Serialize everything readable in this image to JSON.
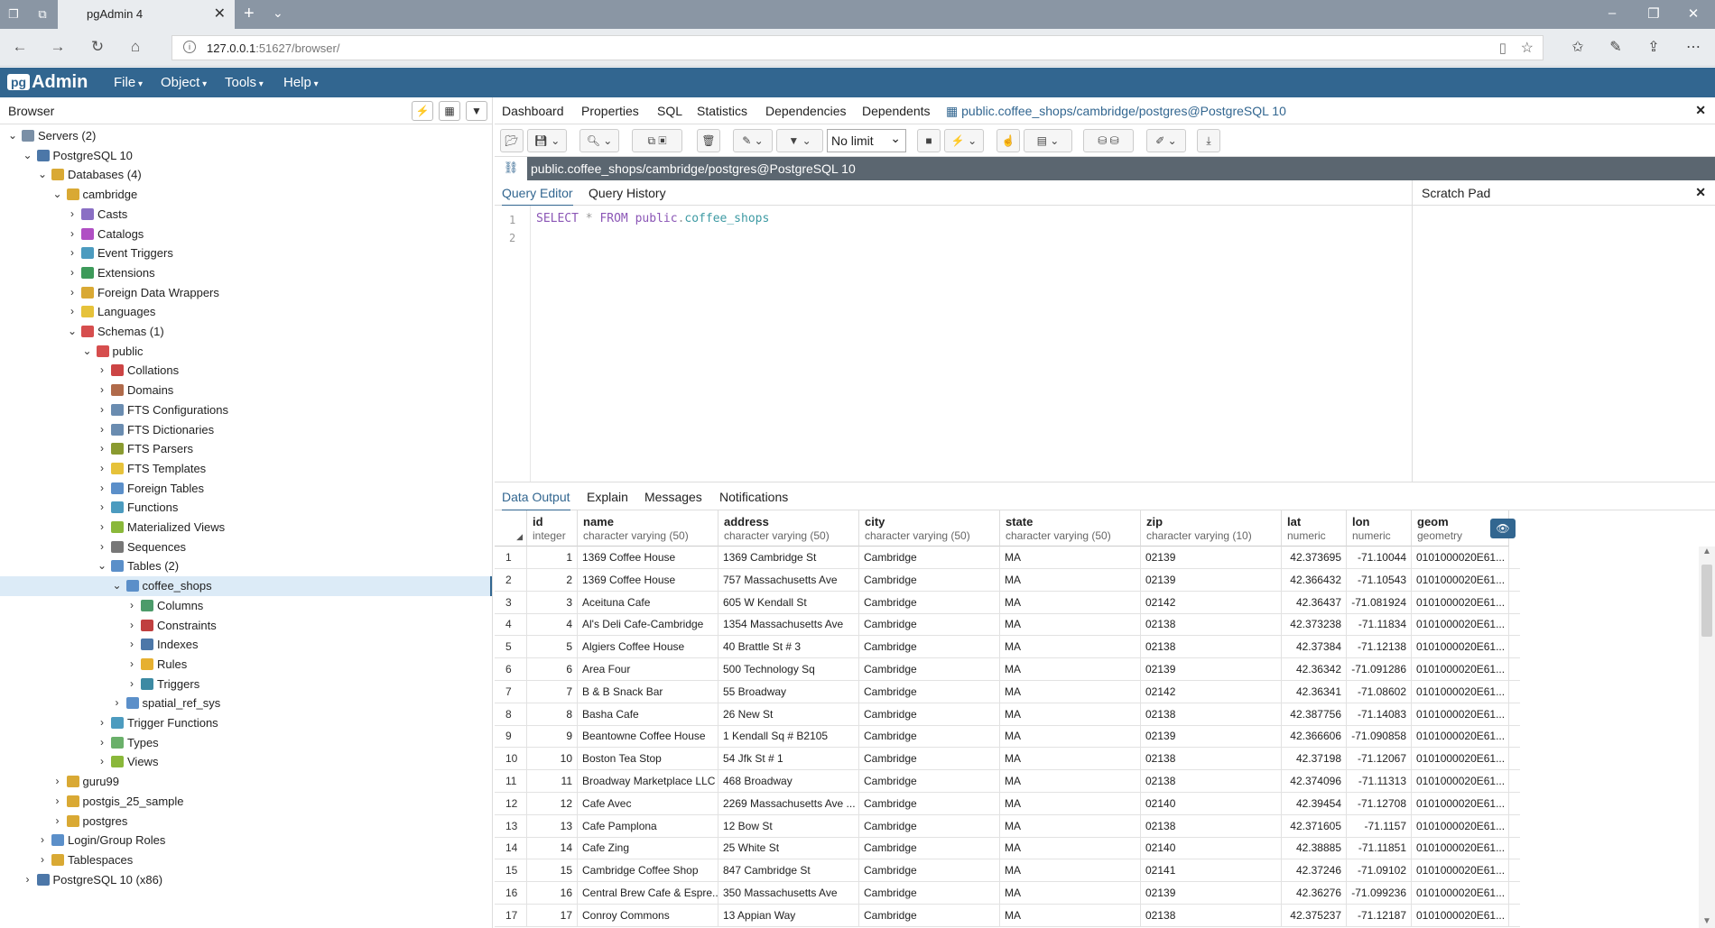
{
  "browser_chrome": {
    "tab_title": "pgAdmin 4",
    "url_host": "127.0.0.1",
    "url_rest": ":51627/browser/"
  },
  "menubar": {
    "logo_pg": "pg",
    "logo_admin": "Admin",
    "items": [
      "File",
      "Object",
      "Tools",
      "Help"
    ]
  },
  "browser_panel": {
    "title": "Browser",
    "tree": [
      {
        "label": "Servers (2)",
        "level": 0,
        "toggle": "open",
        "icon": "servers"
      },
      {
        "label": "PostgreSQL 10",
        "level": 1,
        "toggle": "open",
        "icon": "server"
      },
      {
        "label": "Databases (4)",
        "level": 2,
        "toggle": "open",
        "icon": "databases"
      },
      {
        "label": "cambridge",
        "level": 3,
        "toggle": "open",
        "icon": "database"
      },
      {
        "label": "Casts",
        "level": 4,
        "toggle": "closed",
        "icon": "casts"
      },
      {
        "label": "Catalogs",
        "level": 4,
        "toggle": "closed",
        "icon": "catalogs"
      },
      {
        "label": "Event Triggers",
        "level": 4,
        "toggle": "closed",
        "icon": "event"
      },
      {
        "label": "Extensions",
        "level": 4,
        "toggle": "closed",
        "icon": "extensions"
      },
      {
        "label": "Foreign Data Wrappers",
        "level": 4,
        "toggle": "closed",
        "icon": "fdw"
      },
      {
        "label": "Languages",
        "level": 4,
        "toggle": "closed",
        "icon": "languages"
      },
      {
        "label": "Schemas (1)",
        "level": 4,
        "toggle": "open",
        "icon": "schemas"
      },
      {
        "label": "public",
        "level": 5,
        "toggle": "open",
        "icon": "schema"
      },
      {
        "label": "Collations",
        "level": 6,
        "toggle": "closed",
        "icon": "collations"
      },
      {
        "label": "Domains",
        "level": 6,
        "toggle": "closed",
        "icon": "domains"
      },
      {
        "label": "FTS Configurations",
        "level": 6,
        "toggle": "closed",
        "icon": "fts"
      },
      {
        "label": "FTS Dictionaries",
        "level": 6,
        "toggle": "closed",
        "icon": "fts"
      },
      {
        "label": "FTS Parsers",
        "level": 6,
        "toggle": "closed",
        "icon": "fts-parser"
      },
      {
        "label": "FTS Templates",
        "level": 6,
        "toggle": "closed",
        "icon": "fts-template"
      },
      {
        "label": "Foreign Tables",
        "level": 6,
        "toggle": "closed",
        "icon": "table"
      },
      {
        "label": "Functions",
        "level": 6,
        "toggle": "closed",
        "icon": "functions"
      },
      {
        "label": "Materialized Views",
        "level": 6,
        "toggle": "closed",
        "icon": "views"
      },
      {
        "label": "Sequences",
        "level": 6,
        "toggle": "closed",
        "icon": "sequences"
      },
      {
        "label": "Tables (2)",
        "level": 6,
        "toggle": "open",
        "icon": "table"
      },
      {
        "label": "coffee_shops",
        "level": 7,
        "toggle": "open",
        "icon": "table",
        "selected": true
      },
      {
        "label": "Columns",
        "level": 8,
        "toggle": "closed",
        "icon": "columns"
      },
      {
        "label": "Constraints",
        "level": 8,
        "toggle": "closed",
        "icon": "constraints"
      },
      {
        "label": "Indexes",
        "level": 8,
        "toggle": "closed",
        "icon": "indexes"
      },
      {
        "label": "Rules",
        "level": 8,
        "toggle": "closed",
        "icon": "rules"
      },
      {
        "label": "Triggers",
        "level": 8,
        "toggle": "closed",
        "icon": "triggers"
      },
      {
        "label": "spatial_ref_sys",
        "level": 7,
        "toggle": "closed",
        "icon": "table"
      },
      {
        "label": "Trigger Functions",
        "level": 6,
        "toggle": "closed",
        "icon": "functions"
      },
      {
        "label": "Types",
        "level": 6,
        "toggle": "closed",
        "icon": "types"
      },
      {
        "label": "Views",
        "level": 6,
        "toggle": "closed",
        "icon": "views"
      },
      {
        "label": "guru99",
        "level": 3,
        "toggle": "closed",
        "icon": "database"
      },
      {
        "label": "postgis_25_sample",
        "level": 3,
        "toggle": "closed",
        "icon": "database"
      },
      {
        "label": "postgres",
        "level": 3,
        "toggle": "closed",
        "icon": "database"
      },
      {
        "label": "Login/Group Roles",
        "level": 2,
        "toggle": "closed",
        "icon": "roles"
      },
      {
        "label": "Tablespaces",
        "level": 2,
        "toggle": "closed",
        "icon": "tablespaces"
      },
      {
        "label": "PostgreSQL 10 (x86)",
        "level": 1,
        "toggle": "closed",
        "icon": "server"
      }
    ]
  },
  "main_tabs": [
    "Dashboard",
    "Properties",
    "SQL",
    "Statistics",
    "Dependencies",
    "Dependents",
    "public.coffee_shops/cambridge/postgres@PostgreSQL 10"
  ],
  "toolbar": {
    "limit": "No limit"
  },
  "connection": "public.coffee_shops/cambridge/postgres@PostgreSQL 10",
  "editor_tabs": [
    "Query Editor",
    "Query History"
  ],
  "scratch_pad": "Scratch Pad",
  "editor": {
    "lines": [
      "1",
      "2"
    ],
    "kw_select": "SELECT",
    "star": "*",
    "kw_from": "FROM",
    "schema": "public",
    "dot": ".",
    "table": "coffee_shops"
  },
  "output_tabs": [
    "Data Output",
    "Explain",
    "Messages",
    "Notifications"
  ],
  "grid": {
    "columns": [
      {
        "name": "id",
        "type": "integer"
      },
      {
        "name": "name",
        "type": "character varying (50)"
      },
      {
        "name": "address",
        "type": "character varying (50)"
      },
      {
        "name": "city",
        "type": "character varying (50)"
      },
      {
        "name": "state",
        "type": "character varying (50)"
      },
      {
        "name": "zip",
        "type": "character varying (10)"
      },
      {
        "name": "lat",
        "type": "numeric"
      },
      {
        "name": "lon",
        "type": "numeric"
      },
      {
        "name": "geom",
        "type": "geometry"
      }
    ],
    "rows": [
      [
        "1",
        "1",
        "1369 Coffee House",
        "1369 Cambridge St",
        "Cambridge",
        "MA",
        "02139",
        "42.373695",
        "-71.10044",
        "0101000020E61..."
      ],
      [
        "2",
        "2",
        "1369 Coffee House",
        "757 Massachusetts Ave",
        "Cambridge",
        "MA",
        "02139",
        "42.366432",
        "-71.10543",
        "0101000020E61..."
      ],
      [
        "3",
        "3",
        "Aceituna Cafe",
        "605 W Kendall St",
        "Cambridge",
        "MA",
        "02142",
        "42.36437",
        "-71.081924",
        "0101000020E61..."
      ],
      [
        "4",
        "4",
        "Al's Deli Cafe-Cambridge",
        "1354 Massachusetts Ave",
        "Cambridge",
        "MA",
        "02138",
        "42.373238",
        "-71.11834",
        "0101000020E61..."
      ],
      [
        "5",
        "5",
        "Algiers Coffee House",
        "40 Brattle St # 3",
        "Cambridge",
        "MA",
        "02138",
        "42.37384",
        "-71.12138",
        "0101000020E61..."
      ],
      [
        "6",
        "6",
        "Area Four",
        "500 Technology Sq",
        "Cambridge",
        "MA",
        "02139",
        "42.36342",
        "-71.091286",
        "0101000020E61..."
      ],
      [
        "7",
        "7",
        "B & B Snack Bar",
        "55 Broadway",
        "Cambridge",
        "MA",
        "02142",
        "42.36341",
        "-71.08602",
        "0101000020E61..."
      ],
      [
        "8",
        "8",
        "Basha Cafe",
        "26 New St",
        "Cambridge",
        "MA",
        "02138",
        "42.387756",
        "-71.14083",
        "0101000020E61..."
      ],
      [
        "9",
        "9",
        "Beantowne Coffee House",
        "1 Kendall Sq # B2105",
        "Cambridge",
        "MA",
        "02139",
        "42.366606",
        "-71.090858",
        "0101000020E61..."
      ],
      [
        "10",
        "10",
        "Boston Tea Stop",
        "54 Jfk St # 1",
        "Cambridge",
        "MA",
        "02138",
        "42.37198",
        "-71.12067",
        "0101000020E61..."
      ],
      [
        "11",
        "11",
        "Broadway Marketplace LLC",
        "468 Broadway",
        "Cambridge",
        "MA",
        "02138",
        "42.374096",
        "-71.11313",
        "0101000020E61..."
      ],
      [
        "12",
        "12",
        "Cafe Avec",
        "2269 Massachusetts Ave ...",
        "Cambridge",
        "MA",
        "02140",
        "42.39454",
        "-71.12708",
        "0101000020E61..."
      ],
      [
        "13",
        "13",
        "Cafe Pamplona",
        "12 Bow St",
        "Cambridge",
        "MA",
        "02138",
        "42.371605",
        "-71.1157",
        "0101000020E61..."
      ],
      [
        "14",
        "14",
        "Cafe Zing",
        "25 White St",
        "Cambridge",
        "MA",
        "02140",
        "42.38885",
        "-71.11851",
        "0101000020E61..."
      ],
      [
        "15",
        "15",
        "Cambridge Coffee Shop",
        "847 Cambridge St",
        "Cambridge",
        "MA",
        "02141",
        "42.37246",
        "-71.09102",
        "0101000020E61..."
      ],
      [
        "16",
        "16",
        "Central Brew Cafe & Espre...",
        "350 Massachusetts Ave",
        "Cambridge",
        "MA",
        "02139",
        "42.36276",
        "-71.099236",
        "0101000020E61..."
      ],
      [
        "17",
        "17",
        "Conroy Commons",
        "13 Appian Way",
        "Cambridge",
        "MA",
        "02138",
        "42.375237",
        "-71.12187",
        "0101000020E61..."
      ]
    ]
  },
  "colors": {
    "brand": "#326690",
    "selected_row": "#dcebf7"
  }
}
